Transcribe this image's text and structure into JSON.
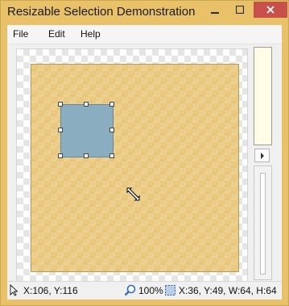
{
  "window": {
    "title": "Resizable Selection Demonstration",
    "accent_color": "#e8c168",
    "close_button_color": "#c7504a"
  },
  "menu": {
    "items": [
      "File",
      "Edit",
      "Help"
    ]
  },
  "canvas": {
    "image_color": "#e8c168",
    "selection_color": "#8aaec0"
  },
  "status": {
    "cursor_position": "X:106, Y:116",
    "zoom": "100%",
    "selection_info": "X:36, Y:49, W:64, H:64"
  },
  "panel": {
    "color_swatch": "#fffde6"
  }
}
